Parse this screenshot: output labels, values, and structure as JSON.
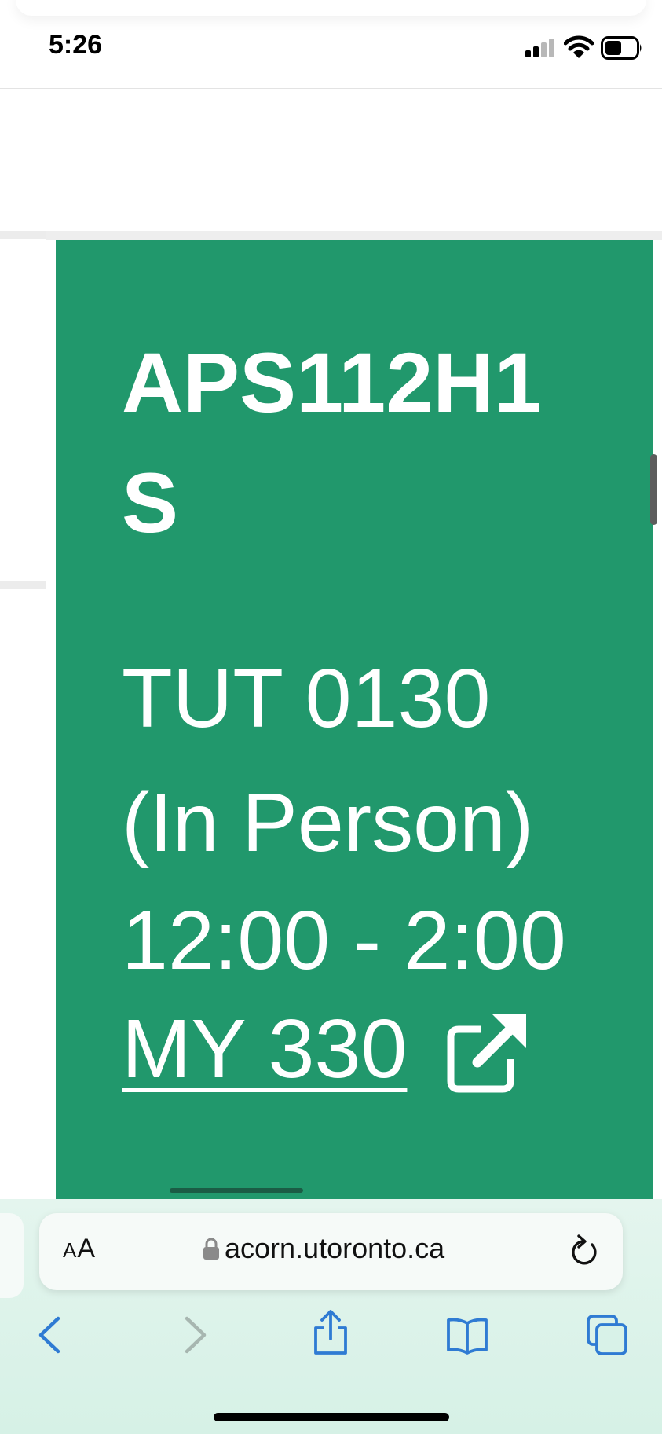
{
  "status_bar": {
    "time": "5:26",
    "icons": [
      "cellular-signal-icon",
      "wifi-icon",
      "battery-icon"
    ]
  },
  "course_card": {
    "background_color": "#21986c",
    "course_code": "APS112H1S",
    "section": "TUT 0130",
    "delivery": "(In Person)",
    "time_range": "12:00 - 2:00",
    "location": "MY 330",
    "location_icon": "external-link-icon"
  },
  "browser": {
    "text_size_label_big": "A",
    "text_size_label_small": "A",
    "url": "acorn.utoronto.ca",
    "accent_color": "#2f7bd3",
    "toolbar": [
      "back-icon",
      "forward-icon",
      "share-icon",
      "bookmarks-icon",
      "tabs-icon"
    ]
  }
}
